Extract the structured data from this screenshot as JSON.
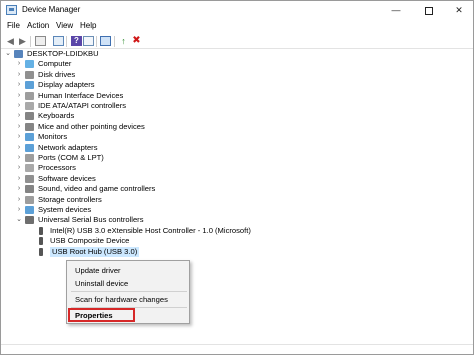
{
  "window": {
    "title": "Device Manager"
  },
  "menu": [
    "File",
    "Action",
    "View",
    "Help"
  ],
  "tree": [
    {
      "label": "DESKTOP-LDIDKBU",
      "arrow": "v",
      "color": "#3a6fb0",
      "icon": "computer-icon"
    },
    {
      "label": "Computer",
      "arrow": ">",
      "color": "#4aa3df",
      "icon": "computer-icon"
    },
    {
      "label": "Disk drives",
      "arrow": ">",
      "color": "#7d7d7d",
      "icon": "disk-drive-icon"
    },
    {
      "label": "Display adapters",
      "arrow": ">",
      "color": "#3f8fd0",
      "icon": "display-adapter-icon"
    },
    {
      "label": "Human Interface Devices",
      "arrow": ">",
      "color": "#8c8c8c",
      "icon": "hid-icon"
    },
    {
      "label": "IDE ATA/ATAPI controllers",
      "arrow": ">",
      "color": "#9a9a9a",
      "icon": "ide-controller-icon"
    },
    {
      "label": "Keyboards",
      "arrow": ">",
      "color": "#6f6f6f",
      "icon": "keyboard-icon"
    },
    {
      "label": "Mice and other pointing devices",
      "arrow": ">",
      "color": "#707070",
      "icon": "mouse-icon"
    },
    {
      "label": "Monitors",
      "arrow": ">",
      "color": "#3f8fd0",
      "icon": "monitor-icon"
    },
    {
      "label": "Network adapters",
      "arrow": ">",
      "color": "#3f8fd0",
      "icon": "network-adapter-icon"
    },
    {
      "label": "Ports (COM & LPT)",
      "arrow": ">",
      "color": "#8c8c8c",
      "icon": "port-icon"
    },
    {
      "label": "Processors",
      "arrow": ">",
      "color": "#9a9a9a",
      "icon": "processor-icon"
    },
    {
      "label": "Software devices",
      "arrow": ">",
      "color": "#7d7d7d",
      "icon": "software-device-icon"
    },
    {
      "label": "Sound, video and game controllers",
      "arrow": ">",
      "color": "#6f6f6f",
      "icon": "speaker-icon"
    },
    {
      "label": "Storage controllers",
      "arrow": ">",
      "color": "#8c8c8c",
      "icon": "storage-controller-icon"
    },
    {
      "label": "System devices",
      "arrow": ">",
      "color": "#3f8fd0",
      "icon": "system-device-icon"
    },
    {
      "label": "Universal Serial Bus controllers",
      "arrow": "v",
      "color": "#555555",
      "icon": "usb-icon"
    },
    {
      "label": "Intel(R) USB 3.0 eXtensible Host Controller - 1.0 (Microsoft)",
      "arrow": "",
      "color": "#555555",
      "icon": "usb-plug-icon",
      "indent": 1
    },
    {
      "label": "USB Composite Device",
      "arrow": "",
      "color": "#555555",
      "icon": "usb-plug-icon",
      "indent": 1
    },
    {
      "label": "USB Root Hub (USB 3.0)",
      "arrow": "",
      "color": "#555555",
      "icon": "usb-plug-icon",
      "indent": 1,
      "selected": true
    }
  ],
  "context_menu": {
    "update": "Update driver",
    "uninstall": "Uninstall device",
    "scan": "Scan for hardware changes",
    "properties": "Properties"
  },
  "colors": {
    "selection": "#cce8ff",
    "highlight_box": "#d62828",
    "close": "#222222"
  }
}
